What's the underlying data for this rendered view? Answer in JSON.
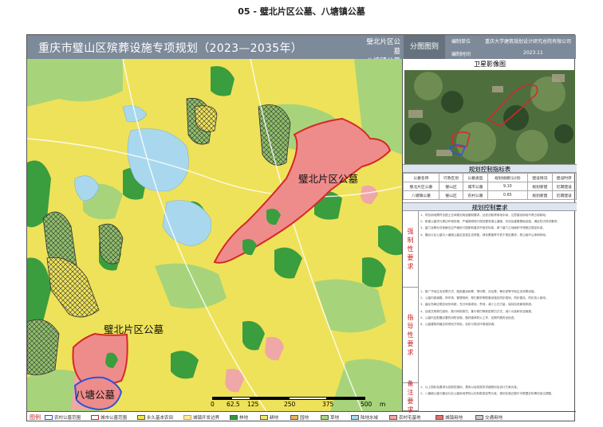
{
  "doc_title": "05 - 璧北片区公墓、八塘镇公墓",
  "banner": {
    "title": "重庆市璧山区殡葬设施专项规划（2023—2035年）",
    "sub_line1": "璧北片区公墓",
    "sub_line2": "八塘镇公墓",
    "tag": "分图图则",
    "org_label": "编制单位",
    "org_value": "重庆大学建筑规划设计研究总院有限公司",
    "time_label": "编制时间",
    "time_value": "2023.11"
  },
  "map": {
    "label_bibei": "璧北片区公墓",
    "label_bibei_south": "璧北片区公墓",
    "label_batang": "八塘公墓",
    "scale_ticks": [
      "0",
      "62.5",
      "125",
      "250",
      "375",
      "500"
    ],
    "scale_unit": "m"
  },
  "satellite": {
    "title": "卫星影像图"
  },
  "index_section": {
    "head": "规划控制指标表",
    "columns": [
      "公墓名称",
      "行政区划",
      "公墓类型",
      "规划规模(公顷)",
      "建设情况",
      "建设时序"
    ],
    "rows": [
      [
        "璧北片区公墓",
        "璧山区",
        "城市公墓",
        "9.10",
        "规划新建",
        "近期建设"
      ],
      [
        "八塘镇公墓",
        "璧山区",
        "农村公墓",
        "0.65",
        "规划新建",
        "近期建设"
      ]
    ]
  },
  "req_section": {
    "head": "规划控制要求",
    "mandatory_label": "强制性要求",
    "guiding_label": "指导性要求",
    "notes_label": "备注要求",
    "mandatory": [
      "1、项目用地需符合国土空间规划用途管制要求，且依法取得用地手续，注意建设用地不得占用耕地。",
      "2、新建公墓须与周边环境协调，严格按照现行规范要求退让道路、河流及重要基础设施，满足防洪排涝要求。",
      "3、墓穴及骨灰存放格位应严格执行国家和重庆市相关标准，单个墓穴占地面积不得超过规定标准。",
      "4、璧北片区公墓与八塘镇公墓应加强生态修复，绿化覆盖率不低于规定要求，禁止破坏山体和林地。"
    ],
    "guiding": [
      "1、推广节地生态安葬方式，鼓励建设树葬、草坪葬、花坛葬、骨灰堂等节地生态安葬设施。",
      "2、公墓内部道路、停车场、管理用房、祭扫服务等配套设施应同步规划、同步建设、同步投入使用。",
      "3、墓区布局应顺应地形地貌，充分利用坡地、荒地，减少土石方量，保持自然景观风貌。",
      "4、加强文明祭扫宣传，推行网络祭扫、集中祭扫等新型祭扫方式，减少污染和安全隐患。",
      "5、公墓内应配置必要的消防设施，做好森林防火工作，定期开展安全检查。",
      "6、公墓建筑风格应体现地方特色，色彩与周边环境相协调。"
    ],
    "notes": [
      "1、以上指标及要求为控制性指标，具体以经批准的详细规划及设计方案为准。",
      "2、八塘镇公墓与璧北片区公墓用地界线以实际勘测定界为准，规划实施过程中可根据实际情况适当调整。"
    ]
  },
  "legend": {
    "head": "图例",
    "items": [
      {
        "label": "农村公墓范围",
        "color": "#ffffff",
        "border": "#2255cc"
      },
      {
        "label": "城市公墓范围",
        "color": "#ffffff",
        "border": "#cc2222"
      },
      {
        "label": "永久基本农田",
        "color": "#f1e64e",
        "border": "#888"
      },
      {
        "label": "城镇开发边界",
        "color": "#ffe9a0",
        "border": "#c9a23a"
      },
      {
        "label": "林地",
        "color": "#2f9a3a",
        "border": "#555"
      },
      {
        "label": "耕地",
        "color": "#f3e76a",
        "border": "#555"
      },
      {
        "label": "园地",
        "color": "#e8b45c",
        "border": "#555"
      },
      {
        "label": "草地",
        "color": "#a9d67c",
        "border": "#555"
      },
      {
        "label": "陆地水域",
        "color": "#a9d8ee",
        "border": "#555"
      },
      {
        "label": "农村宅基地",
        "color": "#f0a7a7",
        "border": "#555"
      },
      {
        "label": "城镇用地",
        "color": "#e36f6f",
        "border": "#555"
      },
      {
        "label": "交通用地",
        "color": "#c9c9c9",
        "border": "#555"
      }
    ]
  },
  "colors": {
    "farmland": "#eee25a",
    "forest": "#3a9d3e",
    "grass": "#a7d47a",
    "water": "#a9d8ee",
    "urban": "#ee8c8c",
    "cemetery_red": "#d62828",
    "cemetery_blue": "#2a56d6"
  }
}
